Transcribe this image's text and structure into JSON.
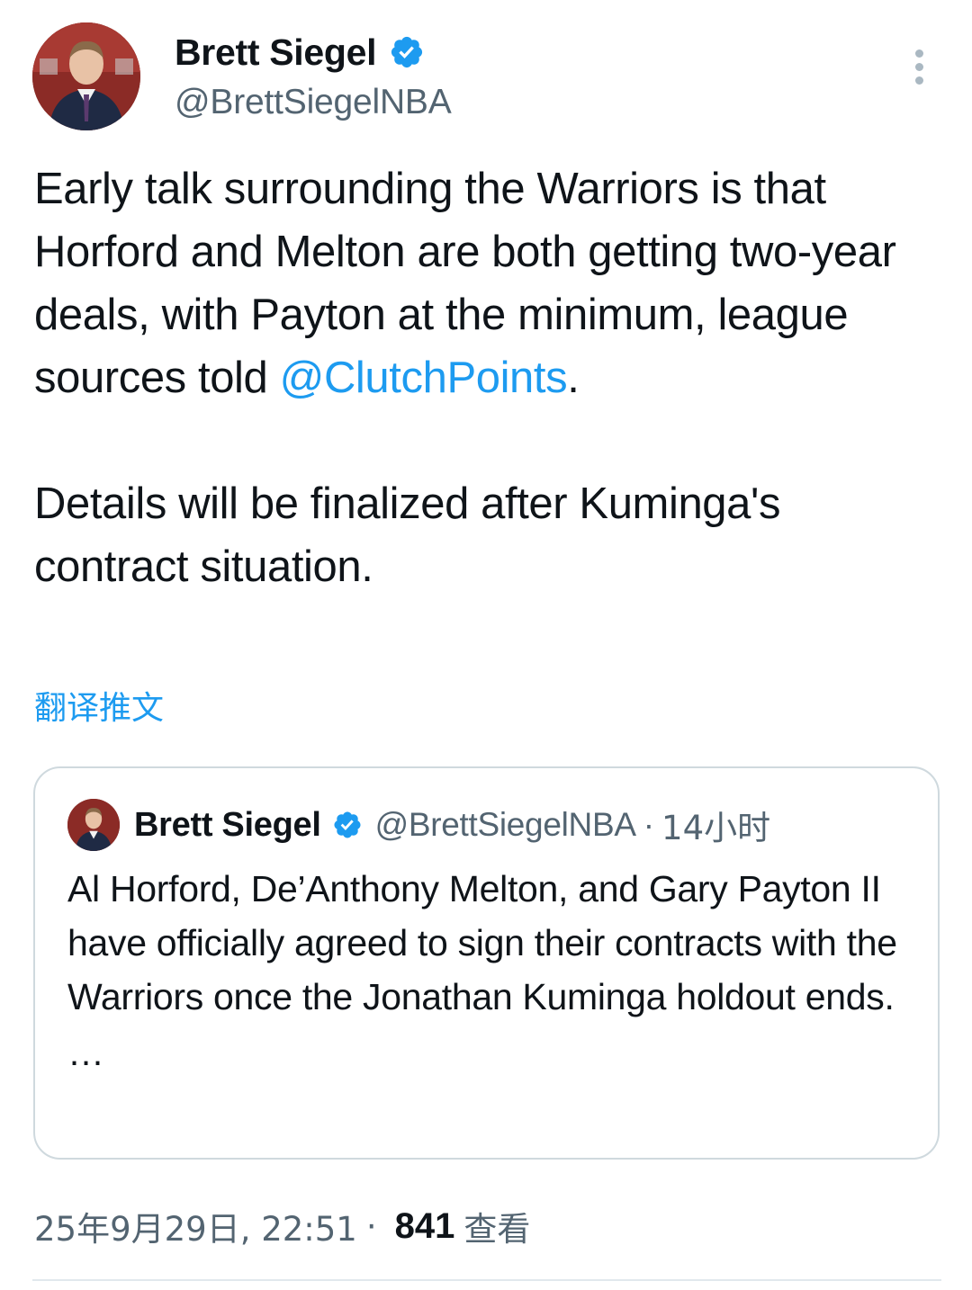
{
  "author": {
    "name": "Brett Siegel",
    "handle": "@BrettSiegelNBA",
    "verified": true,
    "avatar_icon": "profile-photo"
  },
  "tweet": {
    "text_part1": "Early talk surrounding the Warriors is that Horford and Melton are both getting two-year deals, with Payton at the minimum, league sources told ",
    "mention": "@ClutchPoints",
    "text_part1_end": ".",
    "text_part2": "Details will be finalized after Kuminga's contract situation.",
    "translate_label": "翻译推文"
  },
  "quoted_tweet": {
    "name": "Brett Siegel",
    "handle": "@BrettSiegelNBA",
    "separator": "·",
    "time": "14小时",
    "text": "Al Horford, De’Anthony Melton, and Gary Payton II have officially agreed to sign their contracts with the Warriors once the Jonathan Kuminga holdout ends.",
    "ellipsis": "…"
  },
  "meta": {
    "timestamp": "25年9月29日, 22:51",
    "separator": "·",
    "views_count": "841",
    "views_label": "查看"
  },
  "colors": {
    "accent": "#1d9bf0",
    "text": "#0f1419",
    "secondary": "#536471",
    "border": "#cfd9de"
  },
  "icons": {
    "verified": "verified-badge-icon",
    "more": "more-options-icon"
  }
}
